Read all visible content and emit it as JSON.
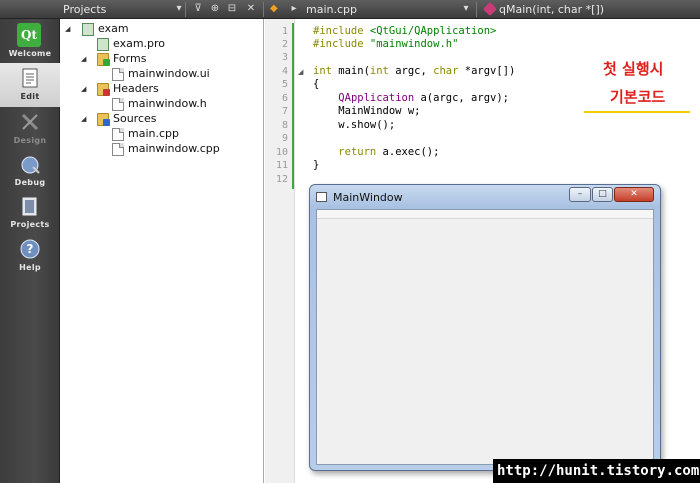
{
  "modes": [
    {
      "label": "Welcome",
      "icon": "qt-logo-icon"
    },
    {
      "label": "Edit",
      "icon": "edit-document-icon"
    },
    {
      "label": "Design",
      "icon": "design-icon"
    },
    {
      "label": "Debug",
      "icon": "debug-icon"
    },
    {
      "label": "Projects",
      "icon": "projects-icon"
    },
    {
      "label": "Help",
      "icon": "help-icon"
    }
  ],
  "qt_logo_text": "Qt",
  "projects_panel": {
    "title": "Projects",
    "tree": [
      {
        "label": "exam"
      },
      {
        "label": "exam.pro"
      },
      {
        "label": "Forms"
      },
      {
        "label": "mainwindow.ui"
      },
      {
        "label": "Headers"
      },
      {
        "label": "mainwindow.h"
      },
      {
        "label": "Sources"
      },
      {
        "label": "main.cpp"
      },
      {
        "label": "mainwindow.cpp"
      }
    ]
  },
  "editor": {
    "file_name": "main.cpp",
    "symbol": "qMain(int, char *[])",
    "line_numbers": [
      "1",
      "2",
      "3",
      "4",
      "5",
      "6",
      "7",
      "8",
      "9",
      "10",
      "11",
      "12"
    ],
    "code": {
      "l1_kw": "#include ",
      "l1_str": "<QtGui/QApplication>",
      "l2_kw": "#include ",
      "l2_str": "\"mainwindow.h\"",
      "l4_a": "int",
      "l4_b": " main(",
      "l4_c": "int",
      "l4_d": " argc, ",
      "l4_e": "char",
      "l4_f": " *argv[])",
      "l5": "{",
      "l6_a": "    ",
      "l6_b": "QApplication",
      "l6_c": " a(argc, argv);",
      "l7": "    MainWindow w;",
      "l8": "    w.show();",
      "l10_a": "    ",
      "l10_b": "return",
      "l10_c": " a.exec();",
      "l11": "}"
    }
  },
  "annotation": {
    "line1": "첫 실행시",
    "line2": "기본코드"
  },
  "main_window": {
    "title": "MainWindow",
    "buttons": [
      "–",
      "□",
      "✕"
    ]
  },
  "watermark": "http://hunit.tistory.com",
  "colors": {
    "annotation": "#e0201c",
    "annotation_underline": "#f0d000",
    "change_bar": "#3aa83a",
    "keyword": "#8a8a00",
    "string": "#008000",
    "type": "#800080"
  }
}
